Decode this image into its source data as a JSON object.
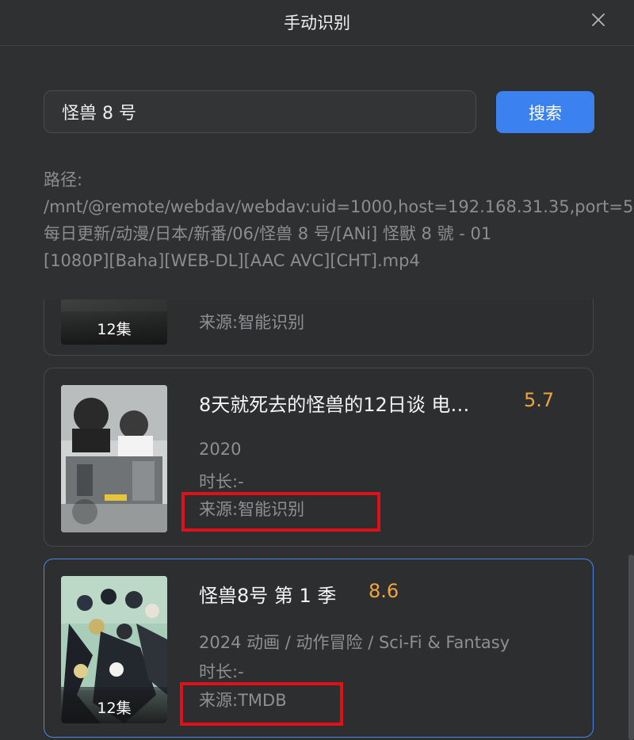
{
  "dialog": {
    "title": "手动识别",
    "close_icon": "close-icon"
  },
  "search": {
    "value": "怪兽 8 号",
    "button_label": "搜索"
  },
  "path": {
    "label": "路径:",
    "line1": "/mnt/@remote/webdav/webdav:uid=1000,host=192.168.31.35,port=5",
    "line2": "每日更新/动漫/日本/新番/06/怪兽 8 号/[ANi] 怪獸 8 號 - 01",
    "line3": "[1080P][Baha][WEB-DL][AAC AVC][CHT].mp4"
  },
  "results": [
    {
      "episodes": "12集",
      "source": "来源:智能识别"
    },
    {
      "title": "8天就死去的怪兽的12日谈 电…",
      "rating": "5.7",
      "year": "2020",
      "duration": "时长:-",
      "source": "来源:智能识别"
    },
    {
      "title": "怪兽8号 第 1 季",
      "rating": "8.6",
      "info": "2024 动画 / 动作冒险 / Sci-Fi & Fantasy",
      "duration": "时长:-",
      "source": "来源:TMDB",
      "episodes": "12集",
      "selected": true
    }
  ],
  "colors": {
    "accent": "#3b82f0",
    "rating": "#f0a53c",
    "highlight_box": "#e0101a",
    "background": "#2f3032"
  }
}
